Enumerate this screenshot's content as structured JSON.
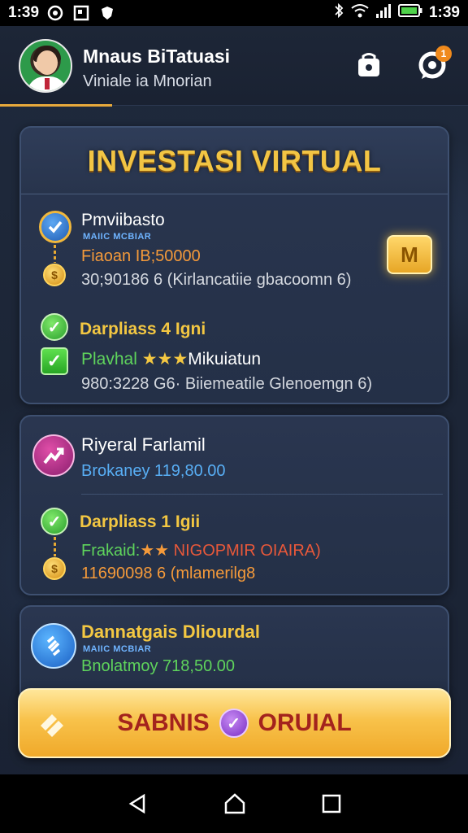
{
  "status_bar": {
    "time_left": "1:39",
    "time_right": "1:39",
    "icons": [
      "circle-icon",
      "square-icon",
      "shield-icon",
      "bluetooth-icon",
      "wifi-icon",
      "signal-icon",
      "battery-icon"
    ]
  },
  "header": {
    "name": "Mnaus BiTatuasi",
    "subtitle": "Viniale ia Mnorian",
    "buttons": [
      "wallet-icon",
      "chat-icon"
    ],
    "notification_count": "1"
  },
  "card_investasi": {
    "title": "INVESTASI VIRTUAL",
    "item1": {
      "title": "Pmviibasto",
      "tag": "MAIIC MCBIAR",
      "amount": "Fiaoan IB;50000",
      "detail": "30;90186 6 (Kirlancatiie gbacoomn 6)"
    },
    "item2": {
      "title": "Darpliass 4 Igni",
      "label": "Plavhal",
      "stars": "★★★",
      "label_suffix": "Mikuiatun",
      "detail": "980:3228 G6· Biiemeatile Glenoemgn 6)"
    },
    "m_badge": "M"
  },
  "card_riveral": {
    "title": "Riyeral Farlamil",
    "amount": "Brokaney 119,80.00",
    "item": {
      "title": "Darpliass 1 Igii",
      "prefix": "Frakaid:",
      "stars": "★★",
      "suffix": "NIGOPMIR OIAIRA)",
      "detail": "11690098 6 (mlamerilg8"
    }
  },
  "card_dannat": {
    "title": "Dannatgais Dliourdal",
    "tag": "MAIIC MCBIAR",
    "amount": "Bnolatmoy 718,50.00"
  },
  "bottom_button": {
    "label_a": "SABNIS",
    "label_b": "ORUIAL"
  },
  "colors": {
    "gold": "#f3c742",
    "orange": "#f59a3a",
    "green": "#5fd45c",
    "blue": "#58aef5"
  }
}
